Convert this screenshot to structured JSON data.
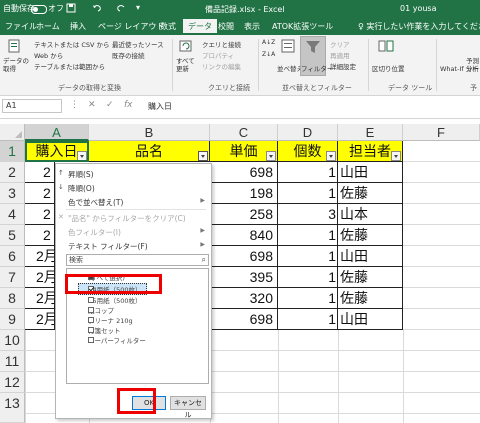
{
  "titlebar": {
    "autosave": "自動保存",
    "autosave_state": "オフ",
    "quick_access": [
      "save-icon",
      "undo-icon",
      "redo-icon"
    ],
    "file_name": "備品記録.xlsx  -  Excel",
    "user": "01 yousa"
  },
  "tabs": [
    "ファイル",
    "ホーム",
    "挿入",
    "ページ レイアウト",
    "数式",
    "データ",
    "校閲",
    "表示",
    "ATOK拡張ツール"
  ],
  "active_tab": "データ",
  "tellme": "♀ 実行したい作業を入力してください",
  "ribbon": {
    "get_data": "データの\n取得",
    "from_text_csv": "テキストまたは CSV から",
    "from_web": "Web から",
    "from_table": "テーブルまたは範囲から",
    "recent_sources": "最近使ったソース",
    "existing_conn": "既存の接続",
    "group_get_transform": "データの取得と変換",
    "refresh_all": "すべて\n更新",
    "queries_conn": "クエリと接続",
    "properties": "プロパティ",
    "edit_links": "リンクの編集",
    "group_queries": "クエリと接続",
    "sort": "並べ替え",
    "filter": "フィルター",
    "clear": "クリア",
    "reapply": "再適用",
    "advanced": "詳細設定",
    "group_sort_filter": "並べ替えとフィルター",
    "text_to_columns": "区切り位置",
    "group_data_tools": "データ ツール",
    "what_if": "What-If 分析",
    "forecast_sheet": "予測\nシート",
    "group_forecast": "予",
    "sort_az": "A↓Z",
    "sort_za": "Z↓A"
  },
  "formula_bar": {
    "name_box": "A1",
    "fx": "fx",
    "content": "購入日"
  },
  "columns": [
    "A",
    "B",
    "C",
    "D",
    "E",
    "F"
  ],
  "rows": [
    "1",
    "2",
    "3",
    "4",
    "5",
    "6",
    "7",
    "8",
    "9",
    "10",
    "11",
    "12",
    "13"
  ],
  "table": {
    "headers": [
      "購入日",
      "品名",
      "単価",
      "個数",
      "担当者"
    ],
    "col_a": [
      "2",
      "2",
      "2",
      "2",
      "2月",
      "2月",
      "2月",
      "2月"
    ],
    "prices": [
      "698",
      "198",
      "258",
      "840",
      "698",
      "395",
      "320",
      "698"
    ],
    "counts": [
      "1",
      "1",
      "3",
      "1",
      "1",
      "1",
      "1",
      "1"
    ],
    "staff": [
      "山田",
      "佐藤",
      "山本",
      "佐藤",
      "山田",
      "佐藤",
      "佐藤",
      "山田"
    ]
  },
  "dropdown": {
    "sort_asc": "昇順(S)",
    "sort_desc": "降順(O)",
    "sort_by_color": "色で並べ替え(T)",
    "clear_filter": "\"品名\" からフィルターをクリア(C)",
    "filter_by_color": "色フィルター(I)",
    "text_filters": "テキスト フィルター(F)",
    "search_placeholder": "検索",
    "items": [
      {
        "label": "(すべて選択)",
        "state": "partial"
      },
      {
        "label": "A4用紙（500枚）",
        "state": "checked"
      },
      {
        "label": "B5用紙（500枚）",
        "state": "unchecked"
      },
      {
        "label": "紙コップ",
        "state": "unchecked"
      },
      {
        "label": "クリーナ 210g",
        "state": "unchecked"
      },
      {
        "label": "付箋セット",
        "state": "unchecked"
      },
      {
        "label": "ペーパーフィルター",
        "state": "unchecked"
      }
    ],
    "ok": "OK",
    "cancel": "キャンセル"
  },
  "colors": {
    "excel_green": "#217346",
    "header_fill": "#ffff00",
    "highlight_red": "#ee0000"
  }
}
